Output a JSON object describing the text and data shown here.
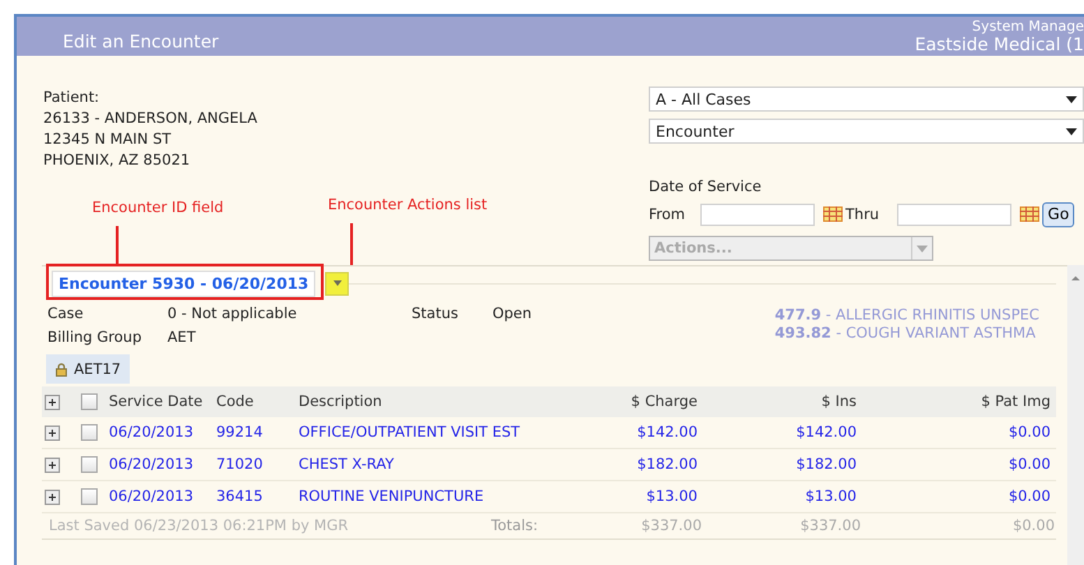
{
  "header": {
    "title": "Edit an Encounter",
    "user": "System Manage",
    "practice": "Eastside Medical (1"
  },
  "patient": {
    "label": "Patient:",
    "lines": [
      "26133 - ANDERSON, ANGELA",
      "12345 N MAIN ST",
      "PHOENIX, AZ 85021"
    ]
  },
  "filters": {
    "case_select": "A - All Cases",
    "type_select": "Encounter",
    "date_label": "Date of Service",
    "from_label": "From",
    "thru_label": "Thru",
    "go_button": "Go",
    "actions": {
      "placeholder": "Actions...",
      "disabled": true
    }
  },
  "annotations": [
    {
      "text": "Encounter ID field"
    },
    {
      "text": "Encounter Actions list"
    }
  ],
  "encounter": {
    "title": "Encounter 5930 - 06/20/2013",
    "fields": [
      {
        "label": "Case",
        "value": "0 - Not applicable"
      },
      {
        "label": "Billing Group",
        "value": "AET"
      }
    ],
    "status_label": "Status",
    "status": "Open",
    "diagnoses": [
      "**477.9** - ALLERGIC RHINITIS UNSPEC",
      "**493.82** - COUGH VARIANT ASTHMA"
    ],
    "tab": "AET17",
    "table": {
      "columns": [
        "Service Date",
        "Code",
        "Description",
        "$ Charge",
        "$ Ins",
        "$ Pat Img"
      ],
      "header_checked": false,
      "rows": [
        {
          "expanded": false,
          "checked": false,
          "cells": [
            "06/20/2013",
            "99214",
            "OFFICE/OUTPATIENT VISIT EST",
            "$142.00",
            "$142.00",
            "$0.00"
          ]
        },
        {
          "expanded": false,
          "checked": false,
          "cells": [
            "06/20/2013",
            "71020",
            "CHEST X-RAY",
            "$182.00",
            "$182.00",
            "$0.00"
          ]
        },
        {
          "expanded": false,
          "checked": false,
          "cells": [
            "06/20/2013",
            "36415",
            "ROUTINE VENIPUNCTURE",
            "$13.00",
            "$13.00",
            "$0.00"
          ]
        }
      ],
      "last_saved": "Last Saved 06/23/2013 06:21PM by MGR",
      "totals_label": "Totals:",
      "totals": [
        "$337.00",
        "$337.00",
        "$0.00"
      ]
    }
  }
}
